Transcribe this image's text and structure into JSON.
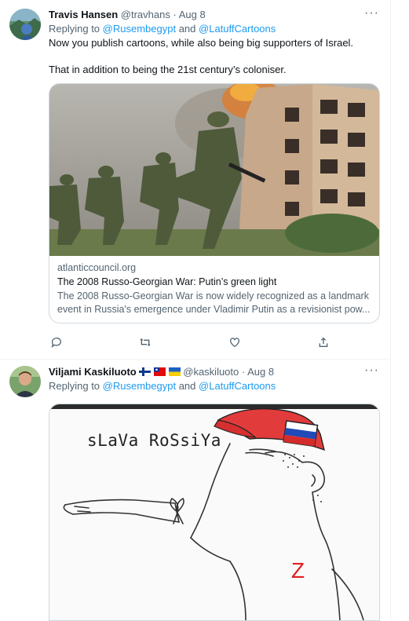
{
  "tweet1": {
    "name": "Travis Hansen",
    "handle": "@travhans",
    "sep": "·",
    "date": "Aug 8",
    "replying_prefix": "Replying to",
    "mention1": "@Rusembegypt",
    "and": "and",
    "mention2": "@LatuffCartoons",
    "text_line1": "Now you publish cartoons, while also being big supporters of Israel.",
    "text_line2": "That in addition to being the 21st century’s coloniser.",
    "card": {
      "domain": "atlanticcouncil.org",
      "title": "The 2008 Russo-Georgian War: Putin’s green light",
      "desc_line1": "The 2008 Russo-Georgian War is now widely recognized as a landmark",
      "desc_line2": "event in Russia's emergence under Vladimir Putin as a revisionist pow..."
    }
  },
  "tweet2": {
    "name": "Viljami Kaskiluoto",
    "flags": [
      "flag-finland-icon",
      "flag-taiwan-icon",
      "flag-ukraine-icon"
    ],
    "handle": "@kaskiluoto",
    "sep": "·",
    "date": "Aug 8",
    "replying_prefix": "Replying to",
    "mention1": "@Rusembegypt",
    "and": "and",
    "mention2": "@LatuffCartoons",
    "cartoon": {
      "caption": "sLaVa RoSsiYa",
      "shirt_letter": "Z"
    }
  },
  "colors": {
    "link": "#1d9bf0",
    "secondary": "#536471",
    "border": "#cfd9de"
  },
  "icons": {
    "more": "more-icon",
    "reply": "reply-icon",
    "retweet": "retweet-icon",
    "like": "like-icon",
    "share": "share-icon"
  }
}
